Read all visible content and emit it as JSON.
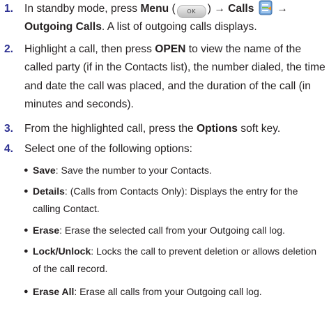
{
  "steps": [
    {
      "number": "1.",
      "t1": "In standby mode, press ",
      "menu": "Menu",
      "open_paren": " (",
      "ok_key": "OK",
      "close_paren": ") → ",
      "calls": "Calls",
      "arrow": " →",
      "outgoing": "Outgoing Calls",
      "t2": ". A list of outgoing calls displays."
    },
    {
      "number": "2.",
      "t1": "Highlight a call, then press ",
      "open": "OPEN",
      "t2": " to view the name of the called party (if in the Contacts list), the number dialed, the time and date the call was placed, and the duration of the call (in minutes and seconds)."
    },
    {
      "number": "3.",
      "t1": "From the highlighted call, press the ",
      "options": "Options",
      "t2": " soft key."
    },
    {
      "number": "4.",
      "t1": "Select one of the following options:"
    }
  ],
  "options": [
    {
      "term": "Save",
      "desc": ": Save the number to your Contacts."
    },
    {
      "term": "Details",
      "desc": ": (Calls from Contacts Only): Displays the entry for the calling Contact."
    },
    {
      "term": "Erase",
      "desc": ": Erase the selected call from your Outgoing call log."
    },
    {
      "term": "Lock/Unlock",
      "desc": ": Locks the call to prevent deletion or allows deletion of the call record."
    },
    {
      "term": "Erase All",
      "desc": ": Erase all calls from your Outgoing call log."
    }
  ],
  "icons": {
    "ok_key": "ok-key-icon",
    "calls": "calls-menu-icon"
  },
  "colors": {
    "step_number": "#2e3192",
    "text": "#231f20"
  }
}
